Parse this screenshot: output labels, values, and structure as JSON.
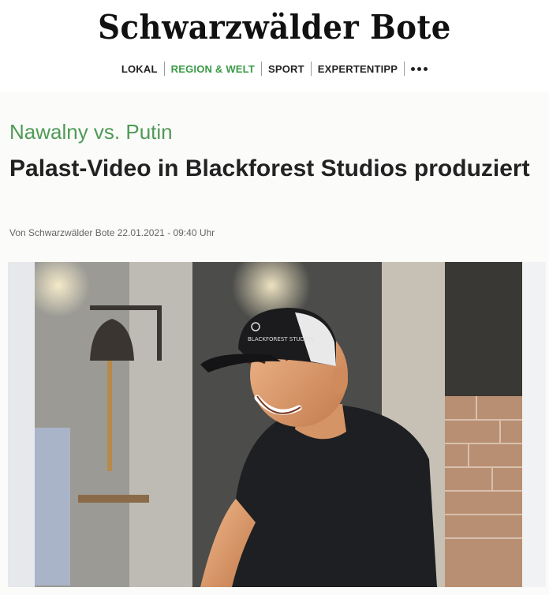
{
  "masthead": {
    "logo": "Schwarzwälder Bote"
  },
  "nav": {
    "items": [
      {
        "label": "LOKAL",
        "active": false
      },
      {
        "label": "REGION & WELT",
        "active": true
      },
      {
        "label": "SPORT",
        "active": false
      },
      {
        "label": "EXPERTENTIPP",
        "active": false
      }
    ],
    "more_icon": "more-dots-icon"
  },
  "article": {
    "kicker": "Nawalny vs. Putin",
    "headline": "Palast-Video in Blackforest Studios produziert",
    "byline": "Von Schwarzwälder Bote 22.01.2021 - 09:40 Uhr"
  },
  "photo": {
    "cap_text": "BLACKFOREST STUDIOS"
  },
  "colors": {
    "accent": "#3a9a45",
    "text": "#222222"
  }
}
